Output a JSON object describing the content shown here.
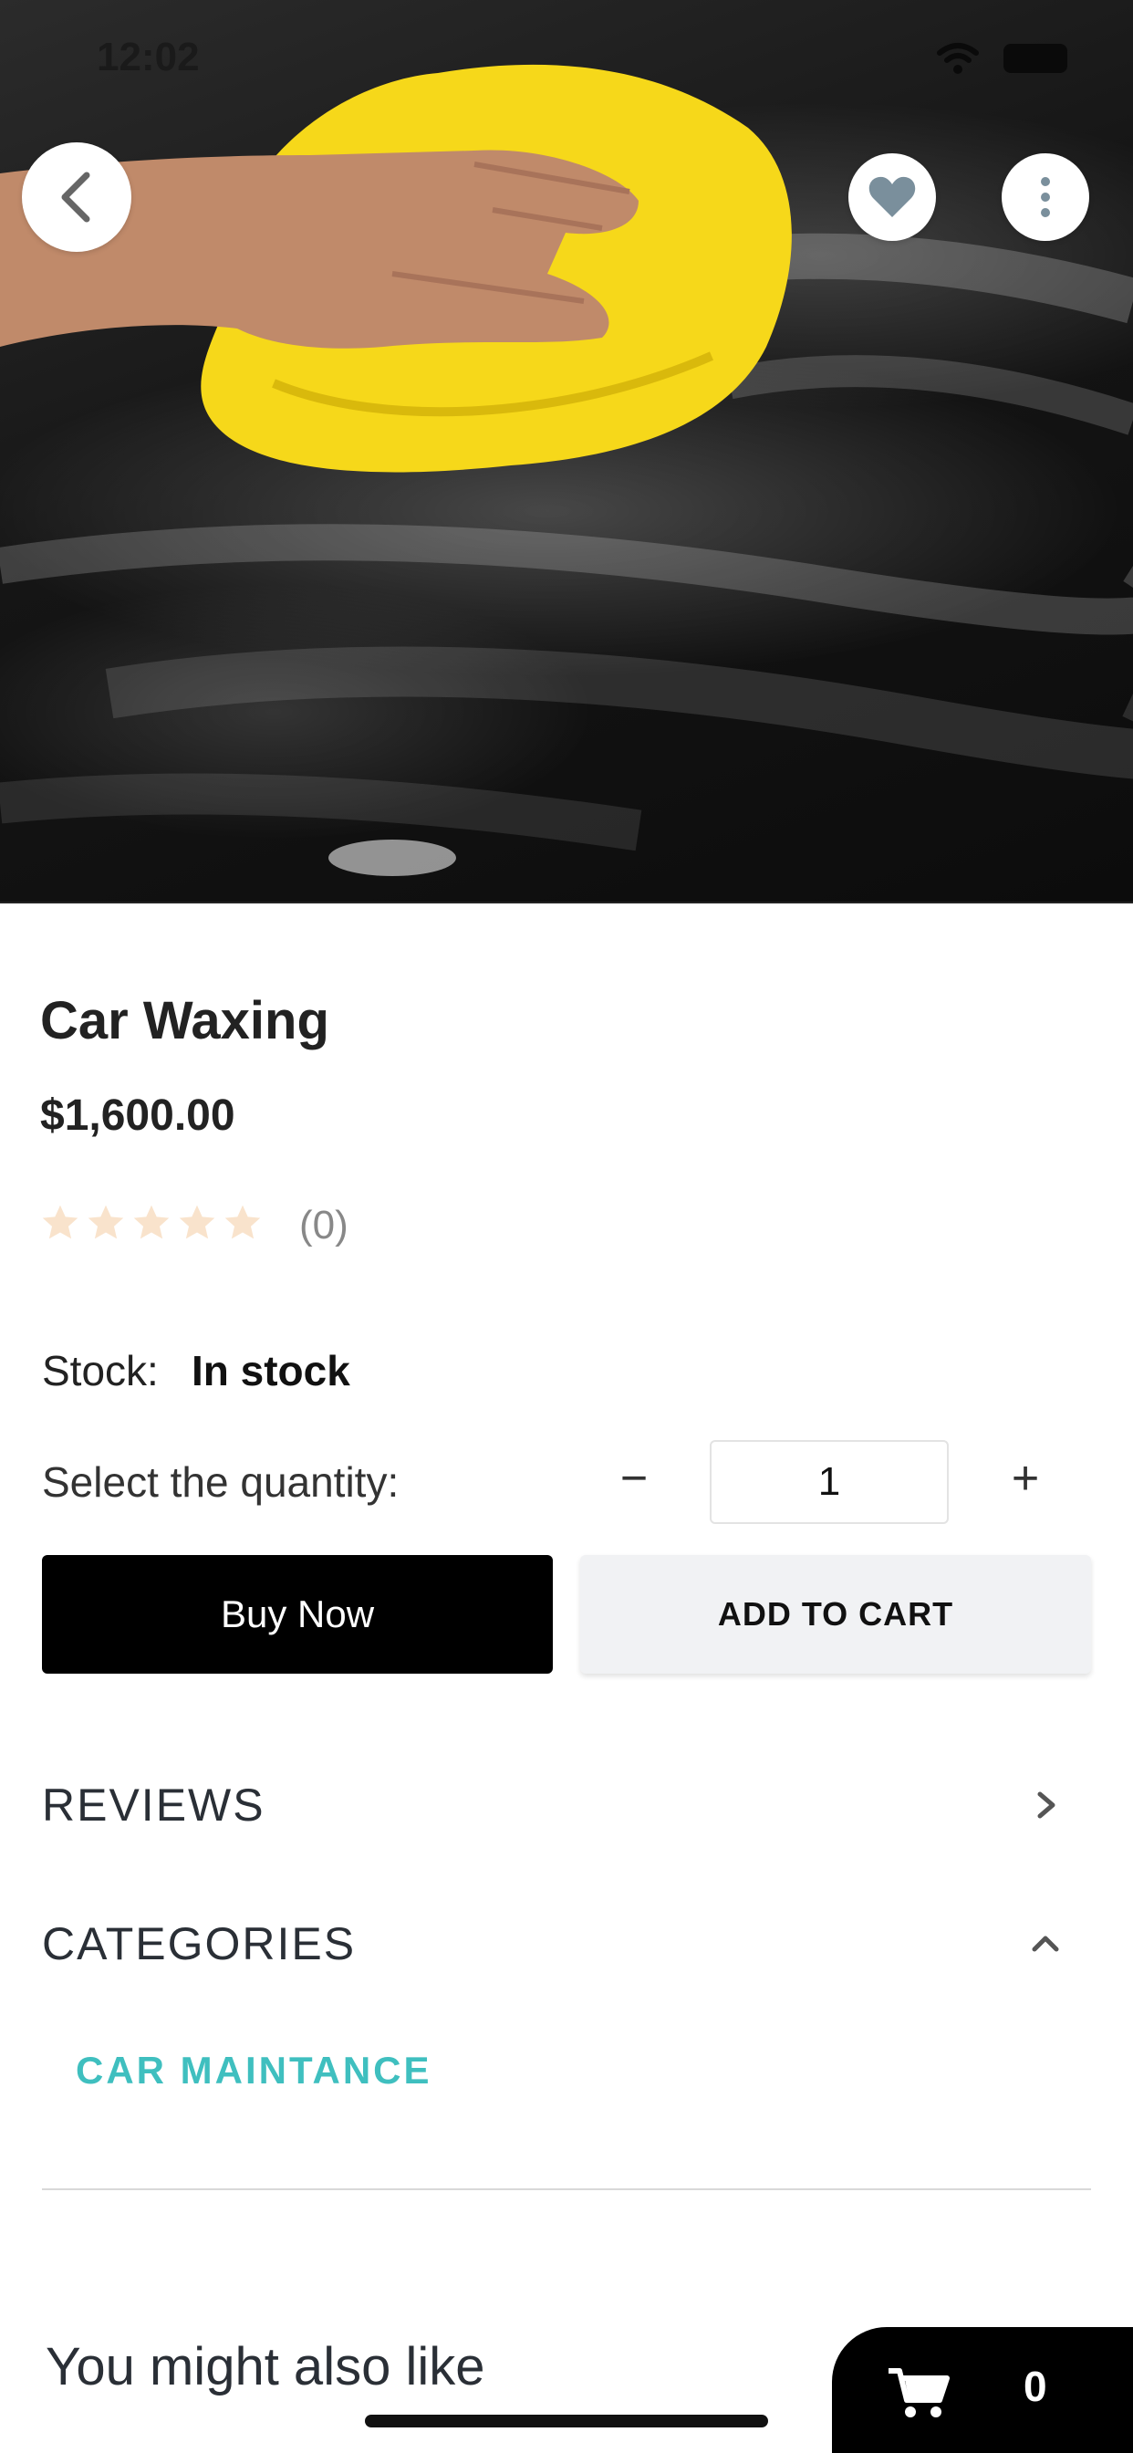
{
  "status_bar": {
    "time": "12:02"
  },
  "product": {
    "title": "Car Waxing",
    "price": "$1,600.00",
    "rating_stars": 0,
    "rating_max": 5,
    "rating_count": "(0)",
    "stock_label": "Stock:",
    "stock_value": "In stock",
    "quantity_label": "Select the quantity:",
    "quantity": "1",
    "quantity_minus": "−",
    "quantity_plus": "+"
  },
  "actions": {
    "buy_now": "Buy Now",
    "add_to_cart": "ADD TO CART"
  },
  "sections": {
    "reviews": "REVIEWS",
    "categories": "CATEGORIES",
    "category_items": [
      "CAR MAINTANCE"
    ]
  },
  "recommendations": {
    "title": "You might also like"
  },
  "cart": {
    "count": "0"
  },
  "colors": {
    "accent_teal": "#3fbfbf",
    "buy_button": "#000000",
    "star_empty": "#f9e3cc"
  },
  "icons": [
    "back-icon",
    "heart-icon",
    "more-vertical-icon",
    "chevron-right-icon",
    "chevron-up-icon",
    "cart-icon",
    "wifi-icon",
    "battery-icon"
  ]
}
